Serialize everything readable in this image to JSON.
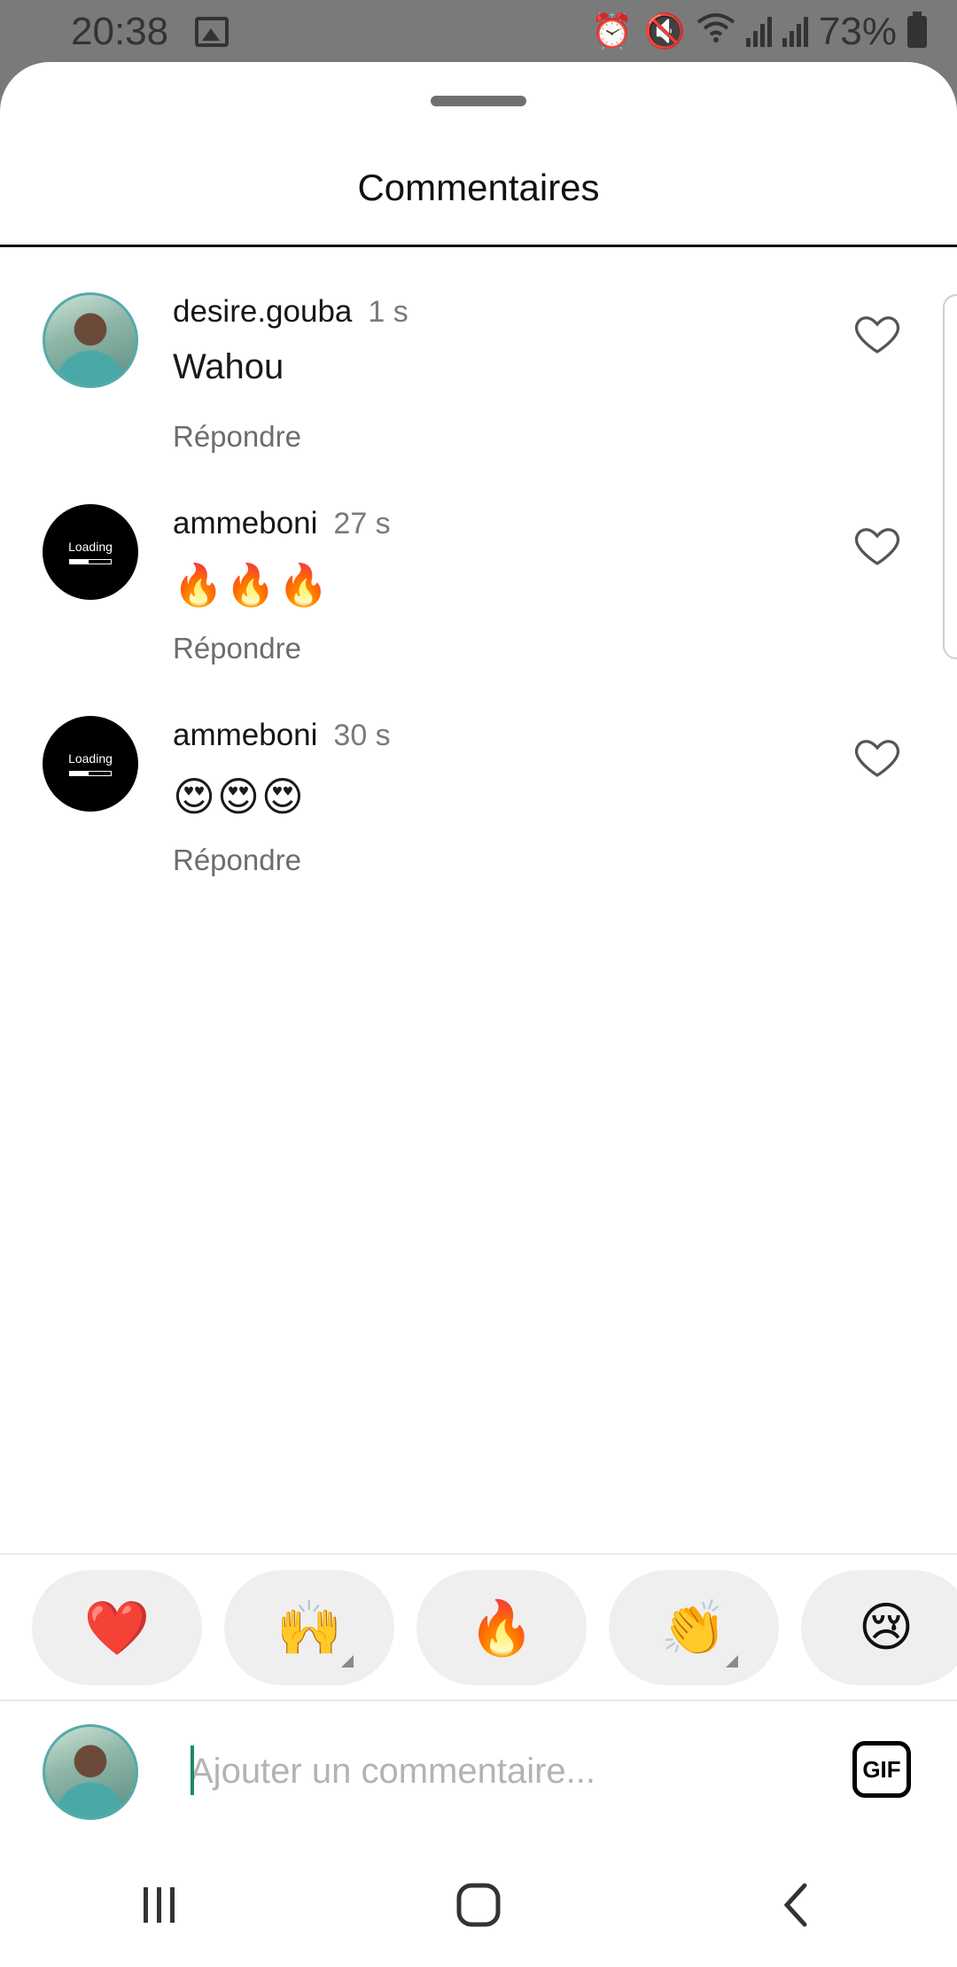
{
  "status_bar": {
    "time": "20:38",
    "battery": "73%",
    "icons": [
      "image-icon",
      "alarm-icon",
      "mute-icon",
      "wifi-icon",
      "signal-icon",
      "signal-icon",
      "battery-icon"
    ]
  },
  "sheet": {
    "title": "Commentaires"
  },
  "comments": [
    {
      "username": "desire.gouba",
      "time": "1 s",
      "text": "Wahou",
      "reply": "Répondre",
      "avatar": "photo"
    },
    {
      "username": "ammeboni",
      "time": "27 s",
      "text": "🔥🔥🔥",
      "reply": "Répondre",
      "avatar": "loading"
    },
    {
      "username": "ammeboni",
      "time": "30 s",
      "text": "😍😍😍",
      "reply": "Répondre",
      "avatar": "loading"
    }
  ],
  "loading_avatar_text": "Loading",
  "reactions": [
    "❤️",
    "🙌",
    "🔥",
    "👏",
    "😢"
  ],
  "composer": {
    "placeholder": "Ajouter un commentaire...",
    "gif_label": "GIF"
  },
  "colors": {
    "status_bar_bg": "#7a7a7a",
    "accent_caret": "#1a8a6a",
    "reaction_bg": "#efefef"
  }
}
